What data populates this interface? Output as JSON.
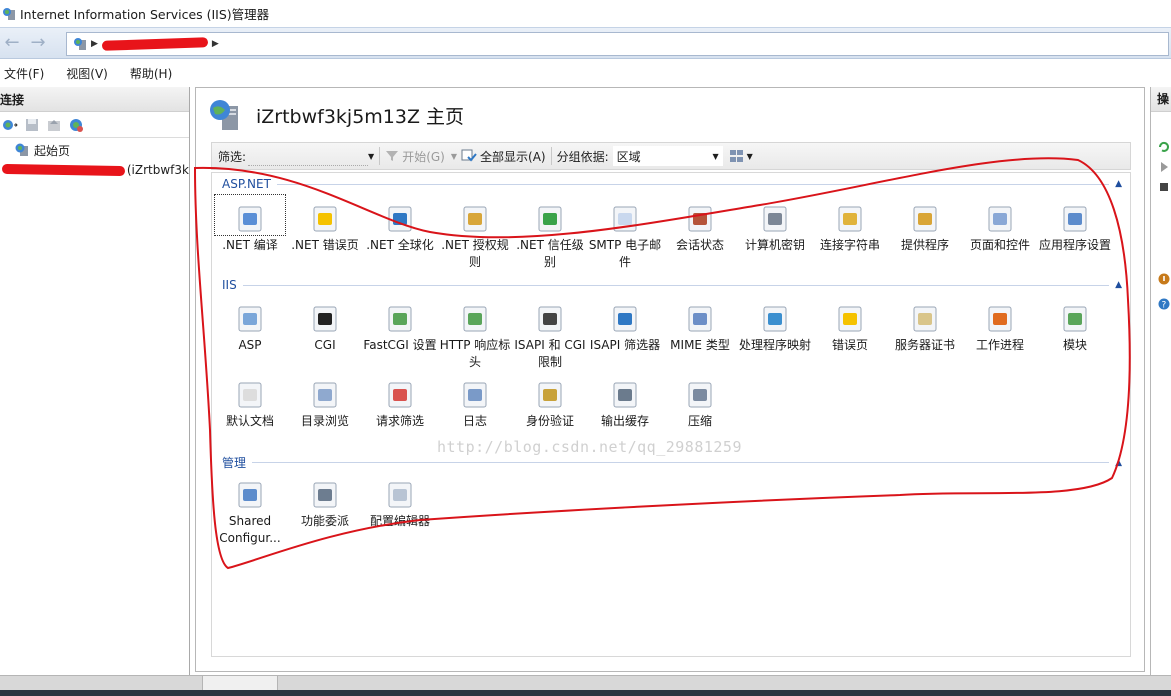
{
  "window": {
    "title": "Internet Information Services (IIS)管理器"
  },
  "menu": [
    "文件(F)",
    "视图(V)",
    "帮助(H)"
  ],
  "connections": {
    "header": "连接",
    "tree": [
      {
        "label": "起始页"
      },
      {
        "label": "(iZrtbwf3k"
      }
    ]
  },
  "home": {
    "title": "iZrtbwf3kj5m13Z 主页"
  },
  "filter": {
    "label": "筛选:",
    "go_label": "开始(G)",
    "showall_label": "全部显示(A)",
    "groupby_label": "分组依据:",
    "groupby_value": "区域"
  },
  "sections": [
    {
      "name": "ASP.NET",
      "features": [
        {
          "label": ".NET 编译",
          "icon": "dotnet-compile-icon",
          "color": "#5b8fd6"
        },
        {
          "label": ".NET 错误页",
          "icon": "dotnet-error-pages-icon",
          "color": "#f5c200"
        },
        {
          "label": ".NET 全球化",
          "icon": "dotnet-globalization-icon",
          "color": "#2f78c4"
        },
        {
          "label": ".NET 授权规则",
          "icon": "dotnet-authorization-icon",
          "color": "#d8a63a"
        },
        {
          "label": ".NET 信任级别",
          "icon": "dotnet-trust-icon",
          "color": "#3aa34a"
        },
        {
          "label": "SMTP 电子邮件",
          "icon": "smtp-email-icon",
          "color": "#c9d8ee"
        },
        {
          "label": "会话状态",
          "icon": "session-state-icon",
          "color": "#b5543a"
        },
        {
          "label": "计算机密钥",
          "icon": "machine-key-icon",
          "color": "#7c8796"
        },
        {
          "label": "连接字符串",
          "icon": "connection-strings-icon",
          "color": "#e0b33b"
        },
        {
          "label": "提供程序",
          "icon": "providers-icon",
          "color": "#d9a536"
        },
        {
          "label": "页面和控件",
          "icon": "pages-controls-icon",
          "color": "#8aa8d6"
        },
        {
          "label": "应用程序设置",
          "icon": "app-settings-icon",
          "color": "#5d8ccc"
        }
      ]
    },
    {
      "name": "IIS",
      "features": [
        {
          "label": "ASP",
          "icon": "asp-icon",
          "color": "#7aa6d9"
        },
        {
          "label": "CGI",
          "icon": "cgi-icon",
          "color": "#222222"
        },
        {
          "label": "FastCGI 设置",
          "icon": "fastcgi-icon",
          "color": "#5aa55a"
        },
        {
          "label": "HTTP 响应标头",
          "icon": "http-headers-icon",
          "color": "#5aa55a"
        },
        {
          "label": "ISAPI 和 CGI 限制",
          "icon": "isapi-cgi-restrictions-icon",
          "color": "#444444"
        },
        {
          "label": "ISAPI 筛选器",
          "icon": "isapi-filters-icon",
          "color": "#2f78c4"
        },
        {
          "label": "MIME 类型",
          "icon": "mime-types-icon",
          "color": "#6d8fc7"
        },
        {
          "label": "处理程序映射",
          "icon": "handler-mappings-icon",
          "color": "#3b8fcf"
        },
        {
          "label": "错误页",
          "icon": "error-pages-icon",
          "color": "#f5c200"
        },
        {
          "label": "服务器证书",
          "icon": "server-certificates-icon",
          "color": "#d9c58a"
        },
        {
          "label": "工作进程",
          "icon": "worker-processes-icon",
          "color": "#e06b1f"
        },
        {
          "label": "模块",
          "icon": "modules-icon",
          "color": "#5aa55a"
        },
        {
          "label": "默认文档",
          "icon": "default-document-icon",
          "color": "#dddddd"
        },
        {
          "label": "目录浏览",
          "icon": "directory-browsing-icon",
          "color": "#8fa9cf"
        },
        {
          "label": "请求筛选",
          "icon": "request-filtering-icon",
          "color": "#d9534f"
        },
        {
          "label": "日志",
          "icon": "logging-icon",
          "color": "#7a9ac8"
        },
        {
          "label": "身份验证",
          "icon": "authentication-icon",
          "color": "#c8a23a"
        },
        {
          "label": "输出缓存",
          "icon": "output-caching-icon",
          "color": "#6b7b8d"
        },
        {
          "label": "压缩",
          "icon": "compression-icon",
          "color": "#7b8aa0"
        }
      ]
    },
    {
      "name": "管理",
      "features": [
        {
          "label": "Shared Configur...",
          "icon": "shared-configuration-icon",
          "color": "#5d8ccc"
        },
        {
          "label": "功能委派",
          "icon": "feature-delegation-icon",
          "color": "#6d7d90"
        },
        {
          "label": "配置编辑器",
          "icon": "configuration-editor-icon",
          "color": "#b8c4d4"
        }
      ]
    }
  ],
  "actions": {
    "header": "操作"
  },
  "watermark": "http://blog.csdn.net/qq_29881259",
  "annotation_color": "#d9141a"
}
